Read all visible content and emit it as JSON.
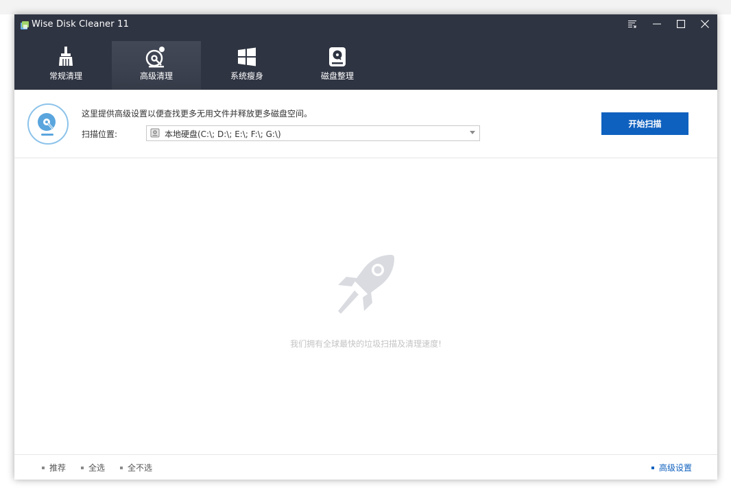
{
  "window": {
    "title": "Wise Disk Cleaner 11"
  },
  "nav": {
    "items": [
      {
        "label": "常规清理",
        "icon": "broom-icon"
      },
      {
        "label": "高级清理",
        "icon": "disk-cleanup-icon"
      },
      {
        "label": "系统瘦身",
        "icon": "windows-icon"
      },
      {
        "label": "磁盘整理",
        "icon": "disk-defrag-icon"
      }
    ],
    "active": "高级清理"
  },
  "scan": {
    "description": "这里提供高级设置以便查找更多无用文件并释放更多磁盘空间。",
    "location_label": "扫描位置:",
    "location_value": "本地硬盘(C:\\; D:\\; E:\\; F:\\; G:\\)",
    "start_button": "开始扫描"
  },
  "main": {
    "empty_message": "我们拥有全球最快的垃圾扫描及清理速度!"
  },
  "footer": {
    "recommend": "推荐",
    "select_all": "全选",
    "select_none": "全不选",
    "advanced_settings": "高级设置"
  },
  "colors": {
    "titlebar": "#2f3442",
    "accent": "#0f61bf",
    "logo_blue": "#5aa5dd"
  }
}
